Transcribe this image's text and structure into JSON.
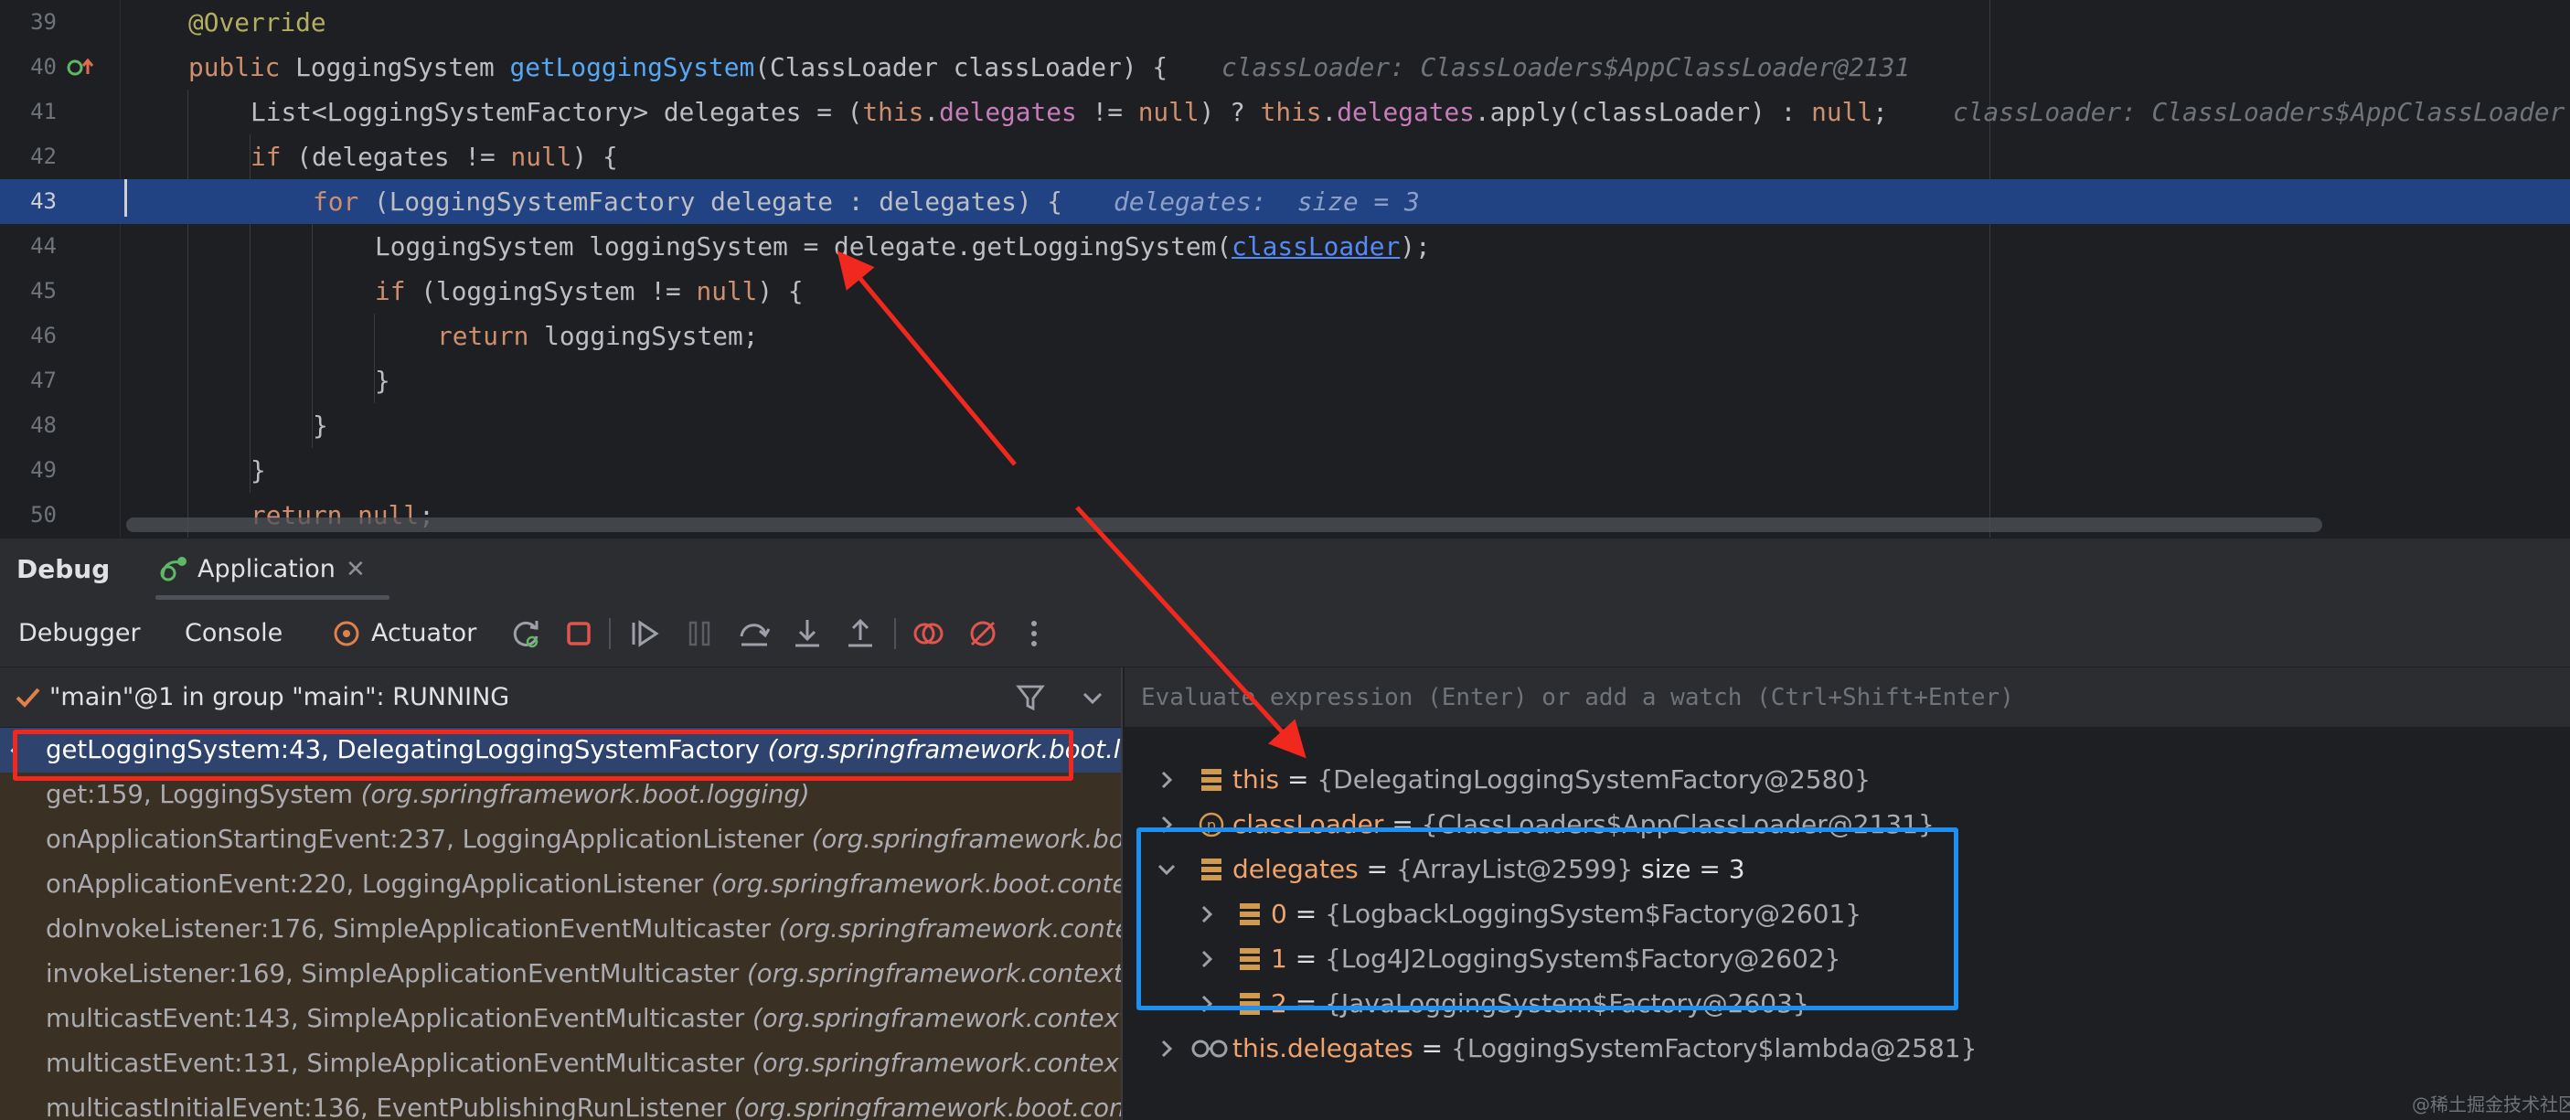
{
  "editor": {
    "lines": [
      {
        "num": "39"
      },
      {
        "num": "40"
      },
      {
        "num": "41"
      },
      {
        "num": "42"
      },
      {
        "num": "43"
      },
      {
        "num": "44"
      },
      {
        "num": "45"
      },
      {
        "num": "46"
      },
      {
        "num": "47"
      },
      {
        "num": "48"
      },
      {
        "num": "49"
      },
      {
        "num": "50"
      }
    ],
    "code": {
      "l39": "@Override",
      "l40_a": "public ",
      "l40_b": "LoggingSystem ",
      "l40_c": "getLoggingSystem",
      "l40_d": "(ClassLoader classLoader) {",
      "l40_inlay": "classLoader: ClassLoaders$AppClassLoader@2131",
      "l41_a": "List<LoggingSystemFactory> delegates = (",
      "l41_b": "this",
      "l41_c": ".",
      "l41_d": "delegates",
      "l41_e": " != ",
      "l41_f": "null",
      "l41_g": ") ? ",
      "l41_h": "this",
      "l41_i": ".",
      "l41_j": "delegates",
      "l41_k": ".apply(classLoader) : ",
      "l41_l": "null",
      "l41_m": ";",
      "l41_inlay": "classLoader: ClassLoaders$AppClassLoader",
      "l42_a": "if ",
      "l42_b": "(delegates != ",
      "l42_c": "null",
      "l42_d": ") {",
      "l43_a": "for ",
      "l43_b": "(LoggingSystemFactory delegate : delegates) {",
      "l43_inlay": "delegates:  size = 3",
      "l44_a": "LoggingSystem loggingSystem = delegate.getLoggingSystem(",
      "l44_b": "classLoader",
      "l44_c": ");",
      "l45_a": "if ",
      "l45_b": "(loggingSystem != ",
      "l45_c": "null",
      "l45_d": ") {",
      "l46_a": "return ",
      "l46_b": "loggingSystem;",
      "l47": "}",
      "l48": "}",
      "l49": "}",
      "l50_a": "return ",
      "l50_b": "null",
      "l50_c": ";"
    }
  },
  "tool_window": {
    "title": "Debug",
    "run_tab": "Application"
  },
  "toolbar": {
    "tab_debugger": "Debugger",
    "tab_console": "Console",
    "tab_actuator": "Actuator"
  },
  "thread": {
    "label": "\"main\"@1 in group \"main\": RUNNING"
  },
  "frames": [
    {
      "method": "getLoggingSystem:43, DelegatingLoggingSystemFactory ",
      "pkg": "(org.springframework.boot.logging)"
    },
    {
      "method": "get:159, LoggingSystem ",
      "pkg": "(org.springframework.boot.logging)"
    },
    {
      "method": "onApplicationStartingEvent:237, LoggingApplicationListener ",
      "pkg": "(org.springframework.boot.context.logging)"
    },
    {
      "method": "onApplicationEvent:220, LoggingApplicationListener ",
      "pkg": "(org.springframework.boot.context.logging)"
    },
    {
      "method": "doInvokeListener:176, SimpleApplicationEventMulticaster ",
      "pkg": "(org.springframework.context.event)"
    },
    {
      "method": "invokeListener:169, SimpleApplicationEventMulticaster ",
      "pkg": "(org.springframework.context.event)"
    },
    {
      "method": "multicastEvent:143, SimpleApplicationEventMulticaster ",
      "pkg": "(org.springframework.context.event)"
    },
    {
      "method": "multicastEvent:131, SimpleApplicationEventMulticaster ",
      "pkg": "(org.springframework.context.event)"
    },
    {
      "method": "multicastInitialEvent:136, EventPublishingRunListener ",
      "pkg": "(org.springframework.boot.context.event)"
    }
  ],
  "evaluate": {
    "placeholder": "Evaluate expression (Enter) or add a watch (Ctrl+Shift+Enter)"
  },
  "variables": [
    {
      "name": "this",
      "eq": " = ",
      "value": "{DelegatingLoggingSystemFactory@2580}",
      "size": ""
    },
    {
      "name": "classLoader",
      "eq": " = ",
      "value": "{ClassLoaders$AppClassLoader@2131}",
      "size": ""
    },
    {
      "name": "delegates",
      "eq": " = ",
      "value": "{ArrayList@2599}",
      "size": "  size = 3"
    },
    {
      "name": "0",
      "eq": " = ",
      "value": "{LogbackLoggingSystem$Factory@2601}",
      "size": ""
    },
    {
      "name": "1",
      "eq": " = ",
      "value": "{Log4J2LoggingSystem$Factory@2602}",
      "size": ""
    },
    {
      "name": "2",
      "eq": " = ",
      "value": "{JavaLoggingSystem$Factory@2603}",
      "size": ""
    },
    {
      "name": "this.delegates",
      "eq": " = ",
      "value": "{LoggingSystemFactory$lambda@2581}",
      "size": ""
    }
  ],
  "watermark": "@稀土掘金技术社区",
  "colors": {
    "accent_selection": "#214283",
    "annotation_red": "#f0281e",
    "annotation_blue": "#1c8ff0",
    "variable_name": "#f0a36c"
  }
}
